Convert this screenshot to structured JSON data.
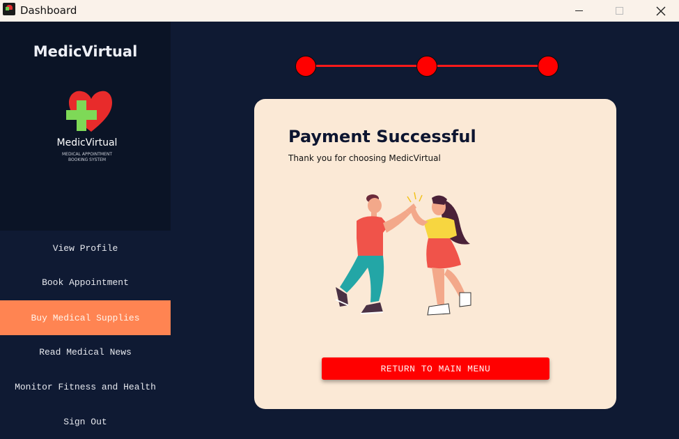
{
  "window": {
    "title": "Dashboard",
    "controls": {
      "minimize": "minimize-icon",
      "maximize": "maximize-icon",
      "close": "close-icon"
    }
  },
  "sidebar": {
    "brand_title": "MedicVirtual",
    "logo": {
      "name": "MedicVirtual",
      "subtitle_line1": "MEDICAL APPOINTMENT",
      "subtitle_line2": "BOOKING SYSTEM"
    },
    "items": [
      {
        "label": "View Profile",
        "active": false
      },
      {
        "label": "Book Appointment",
        "active": false
      },
      {
        "label": "Buy Medical Supplies",
        "active": true
      },
      {
        "label": "Read Medical News",
        "active": false
      },
      {
        "label": "Monitor Fitness and Health",
        "active": false
      },
      {
        "label": "Sign Out",
        "active": false
      }
    ]
  },
  "progress": {
    "steps": 3,
    "completed": 3
  },
  "card": {
    "title": "Payment Successful",
    "subtitle": "Thank you for choosing MedicVirtual",
    "illustration": "high-five-illustration",
    "return_button": "RETURN TO MAIN MENU"
  },
  "colors": {
    "background": "#0f1a33",
    "brand_panel": "#0b1426",
    "active_nav": "#ff8452",
    "card": "#fbe9d6",
    "accent_red": "#ff0000",
    "titlebar": "#faf2ea"
  }
}
